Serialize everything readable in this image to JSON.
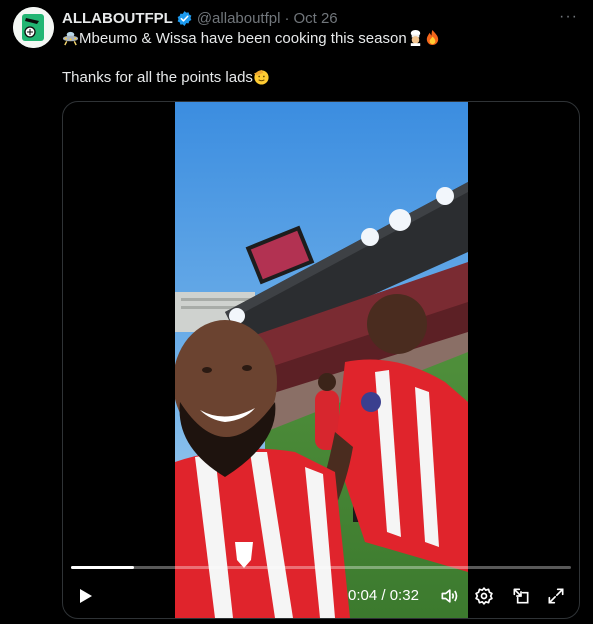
{
  "post": {
    "author_name": "ALLABOUTFPL",
    "handle": "@allaboutfpl",
    "separator": "·",
    "date": "Oct 26",
    "more_label": "···",
    "line1": "Mbeumo & Wissa have been cooking this season",
    "line2": "Thanks for all the points lads"
  },
  "icons": {
    "verified": "verified-badge-icon",
    "line1_prefix": "ufo-emoji",
    "line1_suffix": [
      "cook-emoji",
      "fire-emoji"
    ],
    "line2_suffix": "saluting-face-emoji"
  },
  "video": {
    "current_time": "0:04",
    "time_separator": "/",
    "duration": "0:32",
    "progress_fraction": 0.125
  },
  "colors": {
    "background": "#000000",
    "text": "#e7e9ea",
    "muted": "#71767b",
    "verified": "#1d9bf0",
    "border": "#2f3336"
  }
}
